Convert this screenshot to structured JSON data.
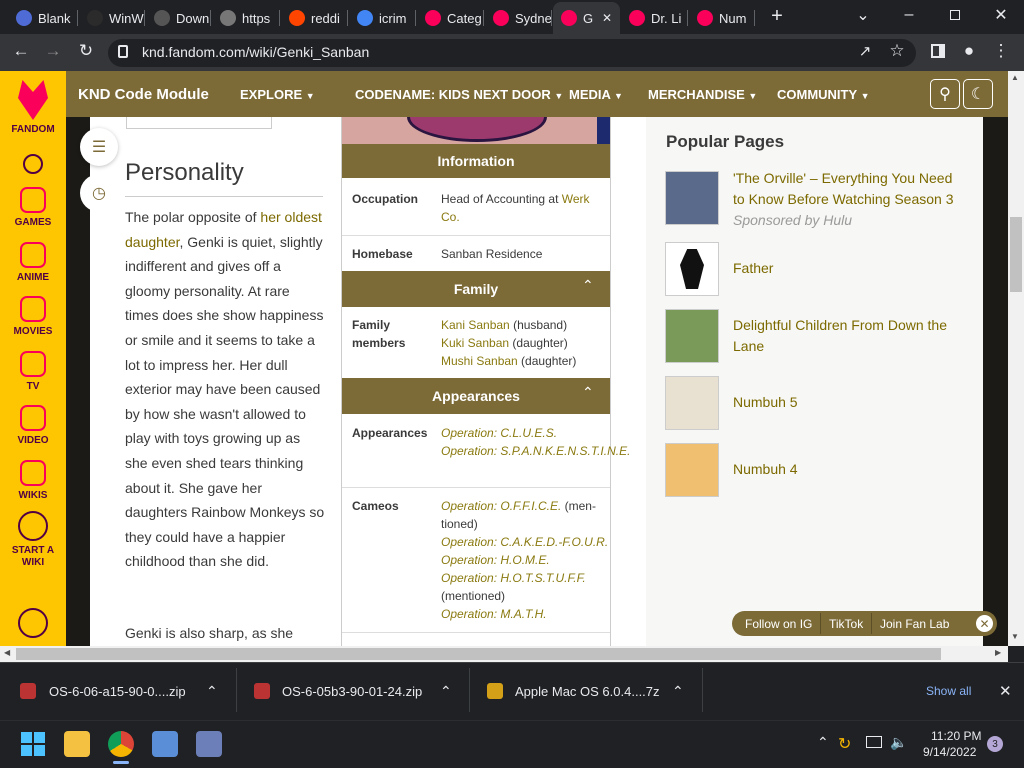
{
  "tabs": [
    {
      "label": "Blank",
      "color": "#4f6bd6"
    },
    {
      "label": "WinW",
      "color": "#2b2b2b"
    },
    {
      "label": "Down",
      "color": "#555"
    },
    {
      "label": "https",
      "color": "#777"
    },
    {
      "label": "reddi",
      "color": "#ff4500"
    },
    {
      "label": "icrim",
      "color": "#4285f4"
    },
    {
      "label": "Categ",
      "color": "#fa005a"
    },
    {
      "label": "Sydne",
      "color": "#fa005a"
    },
    {
      "label": "G",
      "color": "#fa005a"
    },
    {
      "label": "Dr. Li",
      "color": "#fa005a"
    },
    {
      "label": "Num",
      "color": "#fa005a"
    }
  ],
  "url": "knd.fandom.com/wiki/Genki_Sanban",
  "fandom_sidebar": [
    {
      "label": "FANDOM",
      "icon": "fandom-logo-icon"
    },
    {
      "label": "",
      "icon": "search-icon"
    },
    {
      "label": "GAMES",
      "icon": "games-icon"
    },
    {
      "label": "ANIME",
      "icon": "anime-icon"
    },
    {
      "label": "MOVIES",
      "icon": "movies-icon"
    },
    {
      "label": "TV",
      "icon": "tv-icon"
    },
    {
      "label": "VIDEO",
      "icon": "video-icon"
    },
    {
      "label": "WIKIS",
      "icon": "wikis-icon"
    },
    {
      "label": "START A WIKI",
      "icon": "plus-icon"
    },
    {
      "label": "",
      "icon": "user-icon"
    }
  ],
  "global_nav": {
    "site": "KND Code Module",
    "items": [
      "EXPLORE",
      "CODENAME: KIDS NEXT DOOR",
      "MEDIA",
      "MERCHANDISE",
      "COMMUNITY"
    ]
  },
  "article": {
    "heading": "Personality",
    "p1_a": "The polar opposite of ",
    "p1_link": "her oldest daughter",
    "p1_b": ", Genki is quiet, slightly indifferent and gives off a gloomy personality. At rare times does she show happiness or smile and it seems to take a lot to impress her. Her dull exterior may have been caused by how she wasn't allowed to play with toys growing up as she even shed tears thinking about it. She gave her daughters Rainbow Monkeys so they could have a happier childhood than she did.",
    "p2": "Genki is also sharp, as she"
  },
  "infobox": {
    "info_title": "Information",
    "occupation_label": "Occupation",
    "occupation_a": "Head of Accounting at ",
    "occupation_link": "Werk Co.",
    "homebase_label": "Homebase",
    "homebase": "Sanban Residence",
    "family_title": "Family",
    "family_label": "Family members",
    "family": [
      {
        "name": "Kani Sanban",
        "rel": " (husband)"
      },
      {
        "name": "Kuki Sanban",
        "rel": " (daughter)"
      },
      {
        "name": "Mushi Sanban",
        "rel": " (daughter)"
      }
    ],
    "appearances_title": "Appearances",
    "appearances_label": "Appearances",
    "appearances": [
      "Operation: C.L.U.E.S.",
      "Operation: S.P.A.N.K.E.N.S.T.I.N.E."
    ],
    "cameos_label": "Cameos",
    "cameo1": "Operation: O.F.F.I.C.E.",
    "cameo1_note": " (men-",
    "cameo1_note2": "tioned)",
    "cameo2": "Operation: C.A.K.E.D.-F.O.U.R.",
    "cameo3": "Operation: H.O.M.E.",
    "cameo4": "Operation: H.O.T.S.T.U.F.F.",
    "cameo4_note": "(mentioned)",
    "cameo5": "Operation: M.A.T.H."
  },
  "popular": {
    "title": "Popular Pages",
    "items": [
      {
        "title": "'The Orville' – Everything You Need to Know Before Watching Season 3",
        "sponsor": "Sponsored by Hulu"
      },
      {
        "title": "Father"
      },
      {
        "title": "Delightful Children From Down the Lane"
      },
      {
        "title": "Numbuh 5"
      },
      {
        "title": "Numbuh 4"
      }
    ]
  },
  "follow": {
    "ig": "Follow on IG",
    "tiktok": "TikTok",
    "fanlab": "Join Fan Lab"
  },
  "downloads": {
    "items": [
      "OS-6-06-a15-90-0....zip",
      "OS-6-05b3-90-01-24.zip",
      "Apple Mac OS 6.0.4....7z"
    ],
    "show_all": "Show all"
  },
  "taskbar": {
    "time": "11:20 PM",
    "date": "9/14/2022",
    "badge": "3"
  }
}
